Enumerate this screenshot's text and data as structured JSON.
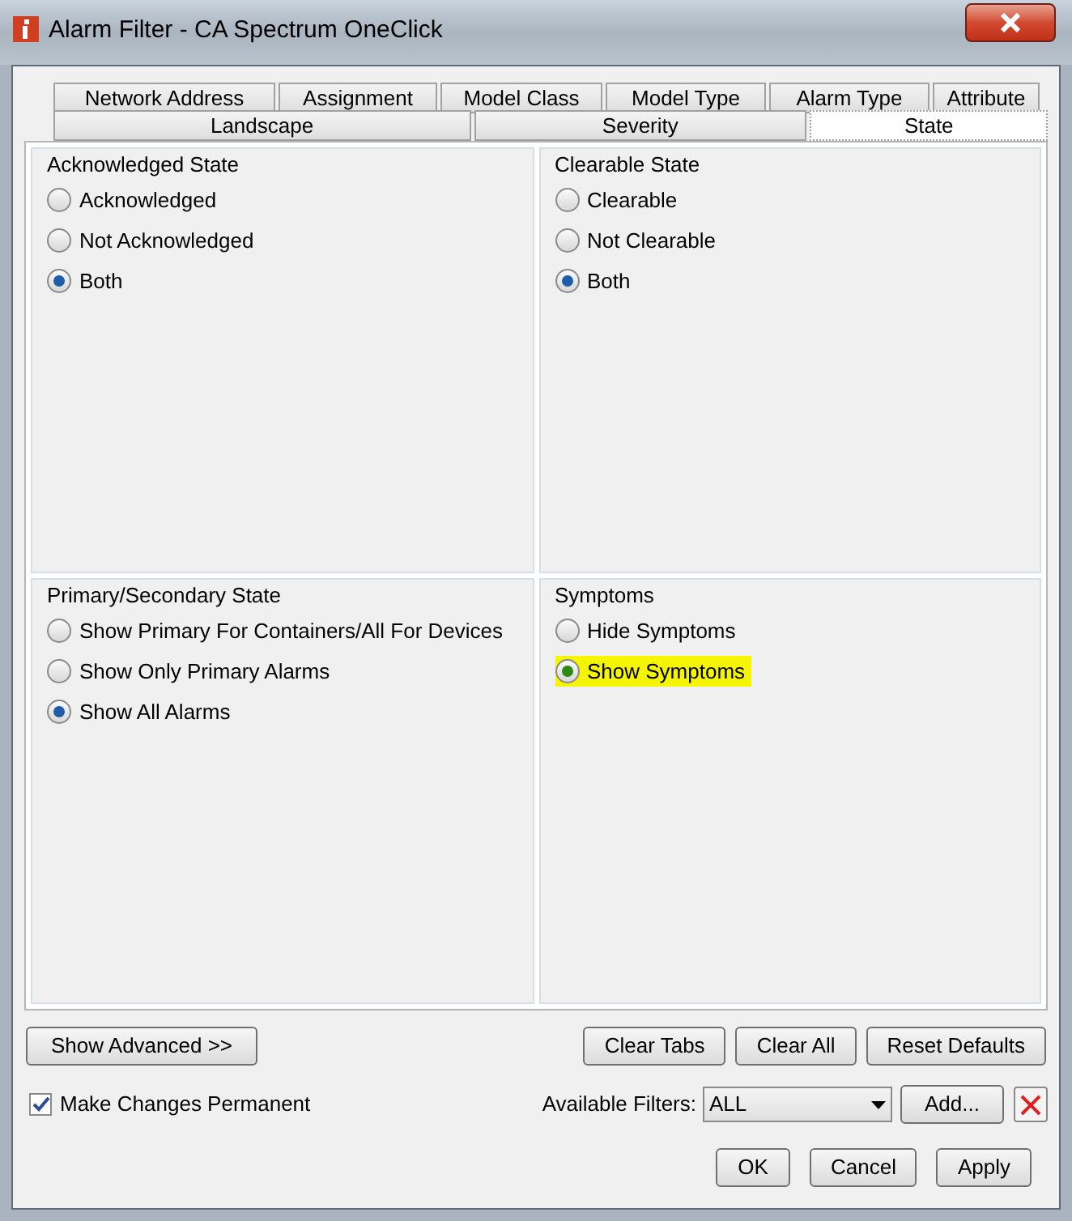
{
  "window": {
    "title": "Alarm Filter - CA Spectrum OneClick"
  },
  "tab_rows": [
    [
      {
        "label": "Network Address",
        "selected": false
      },
      {
        "label": "Assignment",
        "selected": false
      },
      {
        "label": "Model Class",
        "selected": false
      },
      {
        "label": "Model Type",
        "selected": false
      },
      {
        "label": "Alarm Type",
        "selected": false
      },
      {
        "label": "Attribute",
        "selected": false
      }
    ],
    [
      {
        "label": "Landscape",
        "selected": false
      },
      {
        "label": "Severity",
        "selected": false
      },
      {
        "label": "State",
        "selected": true
      }
    ]
  ],
  "groups": [
    {
      "title": "Acknowledged State",
      "options": [
        {
          "label": "Acknowledged",
          "selected": false,
          "highlighted": false
        },
        {
          "label": "Not Acknowledged",
          "selected": false,
          "highlighted": false
        },
        {
          "label": "Both",
          "selected": true,
          "highlighted": false
        }
      ]
    },
    {
      "title": "Clearable State",
      "options": [
        {
          "label": "Clearable",
          "selected": false,
          "highlighted": false
        },
        {
          "label": "Not Clearable",
          "selected": false,
          "highlighted": false
        },
        {
          "label": "Both",
          "selected": true,
          "highlighted": false
        }
      ]
    },
    {
      "title": "Primary/Secondary State",
      "options": [
        {
          "label": "Show Primary For Containers/All For Devices",
          "selected": false,
          "highlighted": false
        },
        {
          "label": "Show Only Primary Alarms",
          "selected": false,
          "highlighted": false
        },
        {
          "label": "Show All Alarms",
          "selected": true,
          "highlighted": false
        }
      ]
    },
    {
      "title": "Symptoms",
      "options": [
        {
          "label": "Hide Symptoms",
          "selected": false,
          "highlighted": false
        },
        {
          "label": "Show Symptoms",
          "selected": true,
          "highlighted": true
        }
      ]
    }
  ],
  "show_advanced": "Show Advanced >>",
  "action_buttons": [
    "Clear Tabs",
    "Clear All",
    "Reset Defaults"
  ],
  "make_permanent": {
    "label": "Make Changes Permanent",
    "checked": true
  },
  "available_filters": {
    "label": "Available Filters:",
    "value": "ALL",
    "add": "Add..."
  },
  "dialog_buttons": [
    "OK",
    "Cancel",
    "Apply"
  ]
}
